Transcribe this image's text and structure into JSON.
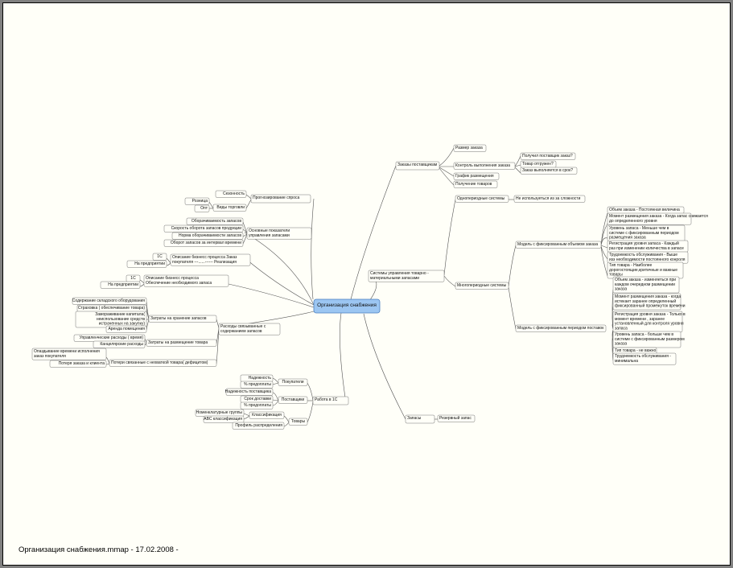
{
  "footer": "Организация снабжения.mmap - 17.02.2008 -",
  "center": {
    "label": "Организация снабжения",
    "color": "#9cc6f2",
    "border": "#4a7fc0"
  },
  "branches": {
    "zakazy_postavshchikam": {
      "label": "Заказы поставщикам",
      "children": {
        "razmer": "Размер заказа",
        "kontrol": {
          "label": "Контроль выполнения заказа",
          "children": [
            "Получил поставщик заказ?",
            "Товар отгружен?",
            "Заказ выполняется в срок?"
          ]
        },
        "grafik": "График размещения",
        "poluchenie": "Получение товаров"
      }
    },
    "sistemy": {
      "label_lines": [
        "Системы управления  товарно -",
        "материальными запасами"
      ],
      "odnoperiodnye": {
        "label": "Однопериодные системы",
        "child": "Не используеться из за сложности"
      },
      "mnogoperiodnye": {
        "label": "Многопериодные системы",
        "fix_obem": {
          "label": "Модель с фиксированным объемом заказа",
          "children": [
            [
              "Объем заказа - Постоянная величина"
            ],
            [
              "Момент размещения заказа - Когда запас снижается",
              "до определенного уровня"
            ],
            [
              "Уровень запаса - Меньше чем в",
              "системе с фиксированным периодом",
              "размещения заказа"
            ],
            [
              "Регистрация уровня запаса - Каждый",
              "раз при изменении количества в запасе"
            ],
            [
              "Трудоемкость обслуживания - Выше",
              "изз необходимости постоянного конроля"
            ],
            [
              "Тип товара - Наиболее",
              "дорогостоящие,критичные и важные",
              "товары"
            ]
          ]
        },
        "fix_period": {
          "label": "Модель с фиксированным периодом поставок",
          "children": [
            [
              "Объем заказа - изменяеться при",
              "каждом очередном размещении",
              "заказа"
            ],
            [
              "Момент размещения заказа -  когда",
              "истекает заранее определенный",
              "фиксированный промежуток времени"
            ],
            [
              "Регистрация уровня заказа - Только в",
              "момент времени , заранее",
              "установленный для контроля уровня",
              "запаса"
            ],
            [
              "Уровень запаса - больше чем в",
              "системе с фиксированным размером",
              "заказа"
            ],
            [
              "Тип товара - не важно"
            ],
            [
              "Трудоемкость обслуживания -",
              "минимальна"
            ]
          ]
        }
      }
    },
    "zapasy": {
      "label": "Запасы",
      "child": "Резервный запас"
    },
    "rabota_1c": {
      "label": "Работа в 1С",
      "pokupateli": {
        "label": "Покупатели",
        "children": [
          "Надежность",
          "% предоплаты"
        ]
      },
      "postavshchiki": {
        "label": "Поставщики",
        "children": [
          "Надежность поставщика",
          "Срок доставки",
          "% предоплаты"
        ]
      },
      "tovary": {
        "label": "Товары",
        "klassifikaciya": {
          "label": "Классификация",
          "children": [
            "Номенклатурные группы",
            "ABC классификация"
          ]
        },
        "profil": "Профиль распределения"
      }
    },
    "prognoz": {
      "label": "Прогнозирование спроса",
      "sezonnost": "Сезонность",
      "vidy": {
        "label": "Виды торговли",
        "children": [
          "Розница",
          "Опт"
        ]
      }
    },
    "osnovnye": {
      "label_lines": [
        "Основные показатели",
        "управления запасами"
      ],
      "children": [
        "Оборачиваемость запасов",
        "Скорость оборота запасов продукции",
        "Норма оборачиваемости запасов",
        "Оборот запасов за интервал времени"
      ]
    },
    "opisanie1": {
      "label_lines": [
        "Описание бизнесс процесса Заказ",
        "покупателя ---......------ Реализация"
      ],
      "c1": "1С",
      "pred": "На предприятии"
    },
    "opisanie2": {
      "label_lines": [
        "Описание бизнесс процесса",
        "Обеспечение необходимого запаса"
      ],
      "c1": "1С",
      "pred": "На предприятии"
    },
    "raskhody": {
      "label_lines": [
        "Расходы связыванные с",
        "содержанием запасов"
      ],
      "khranenie": {
        "label": "Затраты на хранение запасов",
        "children": [
          [
            "Содержание складского оборудования"
          ],
          [
            "Страховка ( обеспечивание товара)"
          ],
          [
            "Замораживание капитала(",
            "неиспользование средств",
            "истраченных на закупку)"
          ],
          [
            "Аренда помещения"
          ]
        ]
      },
      "razmeshchenie": {
        "label": "Затраты на размещение товара",
        "children": [
          "Управленческие расходы ( время)",
          "Канцелярские расходы"
        ]
      },
      "poteri": {
        "label": "Потери связанные с нехваткой товара( дефицитом)",
        "children": [
          [
            "Опаздывание времени исполнения",
            "заказ покупателя"
          ],
          [
            "Потеря заказа и  клиента"
          ]
        ]
      }
    }
  }
}
